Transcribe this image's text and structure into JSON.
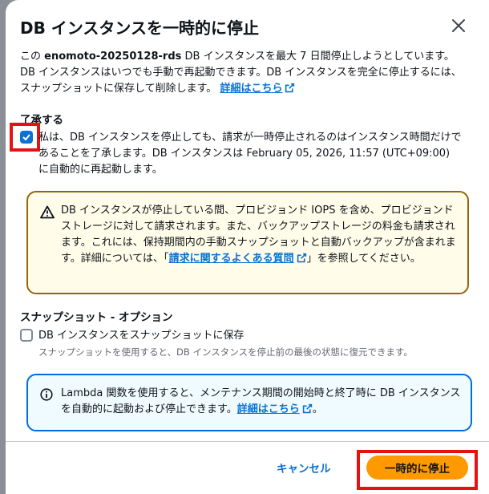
{
  "modal": {
    "title": "DB インスタンスを一時的に停止",
    "close_icon": "close-icon"
  },
  "intro": {
    "prefix": "この ",
    "instance_id": "enomoto-20250128-rds",
    "text": " DB インスタンスを最大 7 日間停止しようとしています。DB インスタンスはいつでも手動で再起動できます。DB インスタンスを完全に停止するには、スナップショットに保存して削除します。",
    "link": "詳細はこちら"
  },
  "acknowledge": {
    "label": "了承する",
    "checked": true,
    "text": "私は、DB インスタンスを停止しても、請求が一時停止されるのはインスタンス時間だけであることを了承します。DB インスタンスは February 05, 2026, 11:57 (UTC+09:00) に自動的に再起動します。"
  },
  "warning": {
    "icon": "warning-icon",
    "text": "DB インスタンスが停止している間、プロビジョンド IOPS を含め、プロビジョンドストレージに対して請求されます。また、バックアップストレージの料金も請求されます。これには、保持期間内の手動スナップショットと自動バックアップが含まれます。詳細については、「",
    "link": "請求に関するよくある質問",
    "suffix": "」を参照してください。"
  },
  "snapshot": {
    "title": "スナップショット - オプション",
    "checkbox_label": "DB インスタンスをスナップショットに保存",
    "checked": false,
    "description": "スナップショットを使用すると、DB インスタンスを停止前の最後の状態に復元できます。"
  },
  "info": {
    "icon": "info-icon",
    "text": "Lambda 関数を使用すると、メンテナンス期間の開始時と終了時に DB インスタンスを自動的に起動および停止できます。",
    "link": "詳細はこちら",
    "suffix": "。"
  },
  "footer": {
    "cancel_label": "キャンセル",
    "primary_label": "一時的に停止"
  },
  "colors": {
    "link": "#0972d3",
    "primary": "#ff9900",
    "warning_border": "#906806",
    "info_border": "#006ce0",
    "highlight": "#e31313"
  }
}
